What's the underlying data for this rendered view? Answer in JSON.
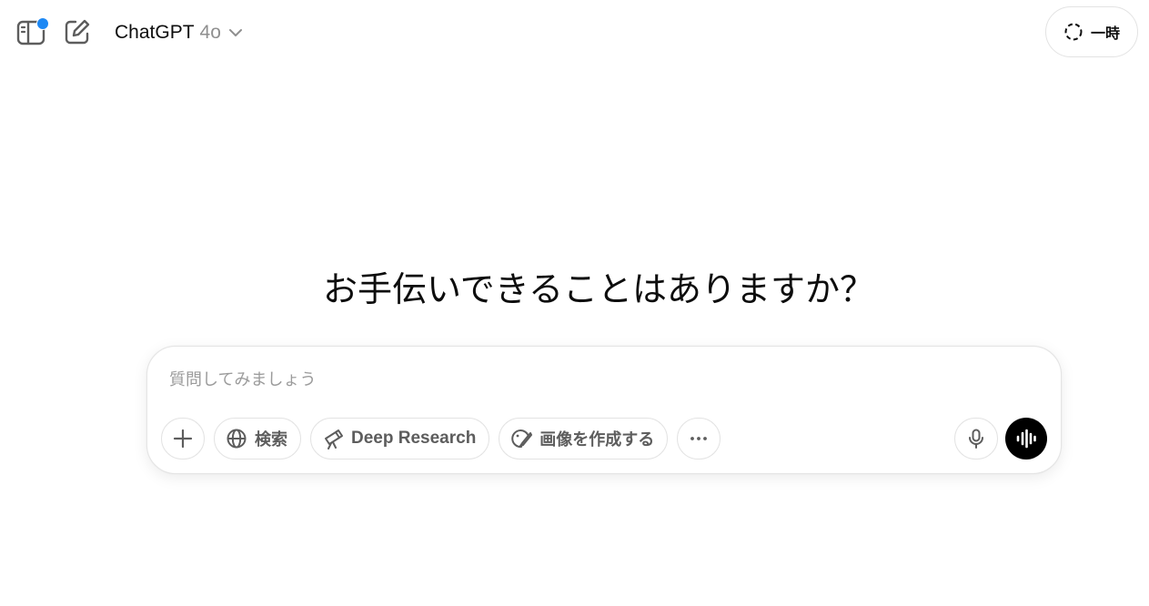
{
  "header": {
    "model_name": "ChatGPT",
    "model_version": "4o",
    "temporary_label": "一時"
  },
  "main": {
    "title": "お手伝いできることはありますか？"
  },
  "composer": {
    "placeholder": "質問してみましょう",
    "tools": {
      "search_label": "検索",
      "deep_research_label": "Deep Research",
      "create_image_label": "画像を作成する"
    }
  },
  "colors": {
    "notification_dot": "#1d88f4",
    "voice_button": "#000000",
    "muted_text": "#9b9b9b"
  },
  "icons": [
    "sidebar-icon",
    "new-chat-icon",
    "chevron-down-icon",
    "temporary-chat-icon",
    "plus-icon",
    "globe-icon",
    "telescope-icon",
    "image-brush-icon",
    "more-icon",
    "microphone-icon",
    "voice-waveform-icon"
  ]
}
